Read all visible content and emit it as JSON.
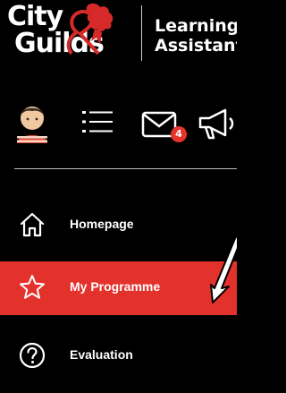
{
  "logo": {
    "word1": "City",
    "word2": "Guilds",
    "line1": "Learning",
    "line2": "Assistant"
  },
  "toolbar": {
    "avatar_icon": "avatar-icon",
    "menu_icon": "hamburger-menu-icon",
    "mail_icon": "mail-icon",
    "mail_badge": "4",
    "megaphone_icon": "megaphone-icon"
  },
  "nav": {
    "items": [
      {
        "label": "Homepage",
        "icon": "home-icon",
        "active": false
      },
      {
        "label": "My Programme",
        "icon": "star-icon",
        "active": true
      },
      {
        "label": "Evaluation",
        "icon": "question-circle-icon",
        "active": false
      }
    ]
  },
  "colors": {
    "background": "#000000",
    "accent": "#e3322b",
    "text": "#ffffff",
    "badge": "#e6342b"
  }
}
